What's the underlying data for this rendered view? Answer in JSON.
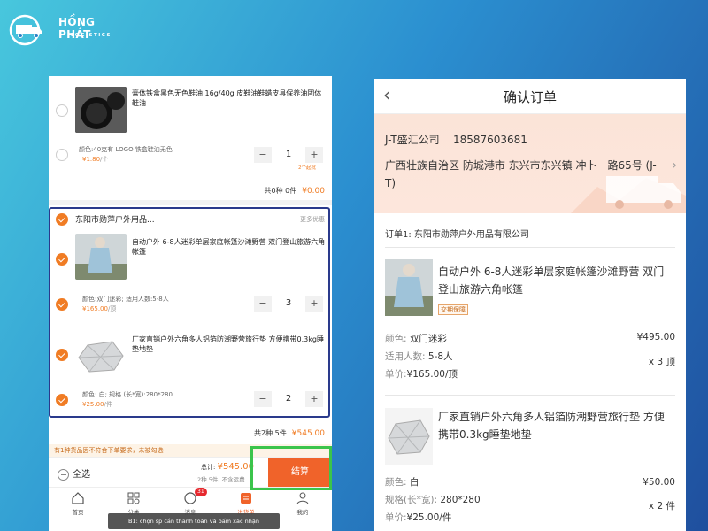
{
  "brand": {
    "name": "HỒNG PHÁT",
    "sub": "LOGISTICS"
  },
  "left": {
    "item0": {
      "name": "膏体铁盒黑色无色鞋油 16g/40g 皮鞋油鞋蜡皮具保养油固体鞋油",
      "spec": "颜色:40克有 LOGO 铁盒鞋油无色",
      "price": "¥1.80",
      "price_unit": "/个",
      "qty": "1",
      "qty_note": "2个起批"
    },
    "group0_summary": {
      "label": "共0种 0件",
      "amount": "¥0.00"
    },
    "shop": {
      "name": "东阳市勋萍户外用品...",
      "more": "更多优惠"
    },
    "item1": {
      "name": "自动户外 6-8人迷彩单层家庭帐篷沙滩野营 双门登山旅游六角帐篷",
      "spec": "颜色:双门迷彩; 适用人数:5-8人",
      "price": "¥165.00",
      "price_unit": "/顶",
      "qty": "3"
    },
    "item2": {
      "name": "厂家直销户外六角多人铝箔防潮野营旅行垫 方便携带0.3kg睡垫地垫",
      "spec": "颜色: 白; 规格 (长*宽):280*280",
      "price": "¥25.00",
      "price_unit": "/件",
      "qty": "2"
    },
    "group1_summary": {
      "label": "共2种 5件",
      "amount": "¥545.00"
    },
    "warning": "有1种货品因不符合下单要求，未被勾选",
    "select_all": "全选",
    "total_label": "总计:",
    "total_amount": "¥545.00",
    "total_sub": "2种 5件; 不含运费",
    "checkout": "结算",
    "tabs": [
      {
        "label": "首页",
        "icon": "home-icon"
      },
      {
        "label": "分类",
        "icon": "category-icon"
      },
      {
        "label": "消息",
        "icon": "message-icon",
        "badge": "31"
      },
      {
        "label": "进货单",
        "icon": "cart-icon"
      },
      {
        "label": "我的",
        "icon": "profile-icon"
      }
    ],
    "toast": "B1: chọn sp cần thanh toán và bấm xác nhận"
  },
  "right": {
    "title": "确认订单",
    "contact": {
      "name": "J-T盛汇公司",
      "phone": "18587603681"
    },
    "address": "广西壮族自治区 防城港市 东兴市东兴镇 冲卜一路65号 (J-T)",
    "order_label": "订单1: 东阳市勋萍户外用品有限公司",
    "p1": {
      "name": "自动户外 6-8人迷彩单层家庭帐篷沙滩野营 双门登山旅游六角帐篷",
      "tag": "交期保障",
      "color_label": "颜色:",
      "color": "双门迷彩",
      "people_label": "适用人数:",
      "people": "5-8人",
      "unit_label": "单价:",
      "unit": "¥165.00/顶",
      "total": "¥495.00",
      "qty": "x 3 顶"
    },
    "p2": {
      "name": "厂家直销户外六角多人铝箔防潮野营旅行垫 方便携带0.3kg睡垫地垫",
      "color_label": "颜色:",
      "color": "白",
      "size_label": "规格(长*宽):",
      "size": "280*280",
      "unit_label": "单价:",
      "unit": "¥25.00/件",
      "total": "¥50.00",
      "qty": "x 2 件"
    }
  }
}
